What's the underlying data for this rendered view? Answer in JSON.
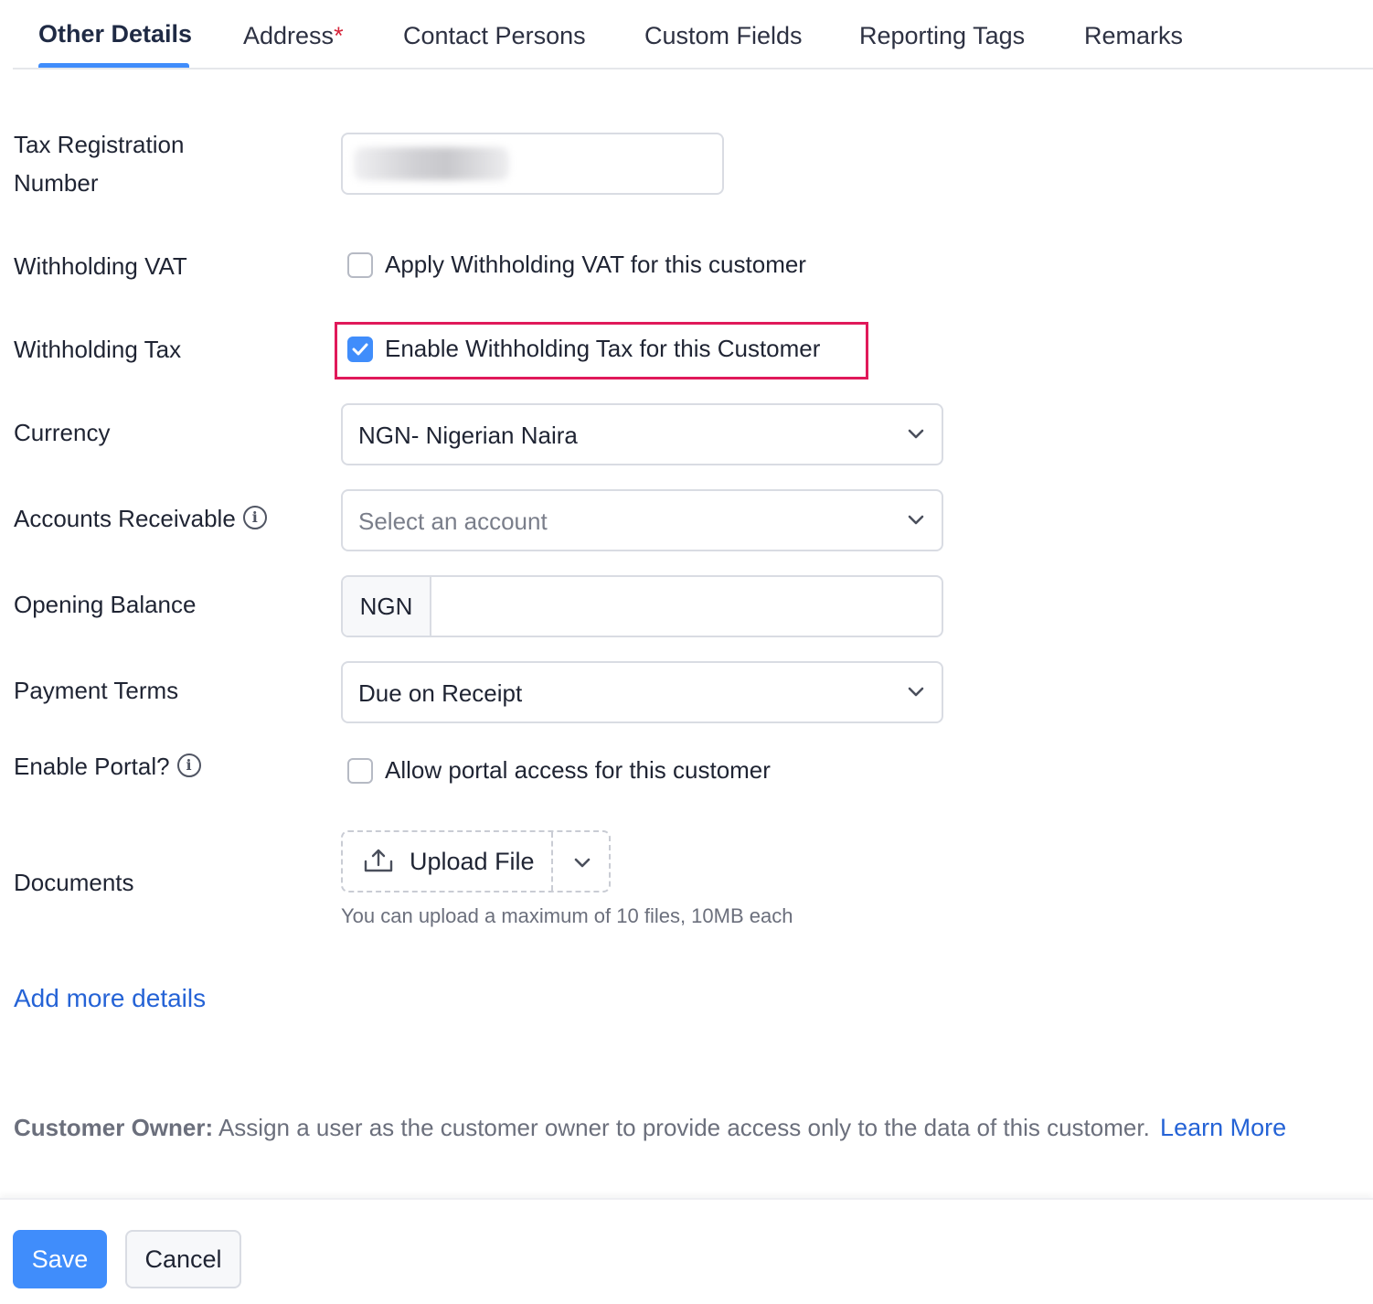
{
  "tabs": [
    {
      "label": "Other Details",
      "active": true
    },
    {
      "label": "Address",
      "required_mark": "*"
    },
    {
      "label": "Contact Persons"
    },
    {
      "label": "Custom Fields"
    },
    {
      "label": "Reporting Tags"
    },
    {
      "label": "Remarks"
    }
  ],
  "form": {
    "tax_registration": {
      "label_line1": "Tax Registration",
      "label_line2": "Number",
      "value": ""
    },
    "withholding_vat": {
      "label": "Withholding VAT",
      "checkbox_label": "Apply Withholding VAT for this customer",
      "checked": false
    },
    "withholding_tax": {
      "label": "Withholding Tax",
      "checkbox_label": "Enable Withholding Tax for this Customer",
      "checked": true
    },
    "currency": {
      "label": "Currency",
      "value": "NGN- Nigerian Naira"
    },
    "accounts_receivable": {
      "label": "Accounts Receivable",
      "placeholder": "Select an account",
      "info_icon": "info-icon"
    },
    "opening_balance": {
      "label": "Opening Balance",
      "prefix": "NGN",
      "value": ""
    },
    "payment_terms": {
      "label": "Payment Terms",
      "value": "Due on Receipt"
    },
    "enable_portal": {
      "label": "Enable Portal?",
      "checkbox_label": "Allow portal access for this customer",
      "checked": false,
      "info_icon": "info-icon"
    },
    "documents": {
      "label": "Documents",
      "upload_label": "Upload File",
      "hint": "You can upload a maximum of 10 files, 10MB each"
    }
  },
  "add_more_details": "Add more details",
  "customer_owner": {
    "title": "Customer Owner:",
    "text": "Assign a user as the customer owner to provide access only to the data of this customer.",
    "link": "Learn More"
  },
  "footer": {
    "save_label": "Save",
    "cancel_label": "Cancel"
  },
  "colors": {
    "accent": "#408dfb",
    "link": "#2563d6",
    "highlight": "#e0195a",
    "required": "#d6253a"
  }
}
